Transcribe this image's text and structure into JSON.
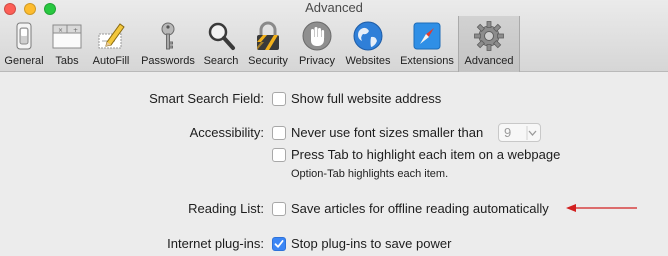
{
  "window": {
    "title": "Advanced",
    "traffic_colors": [
      "#fd5f57",
      "#fdbc2e",
      "#28c840"
    ]
  },
  "toolbar": {
    "tabs": [
      {
        "label": "General",
        "icon": "general-switch-icon",
        "active": false
      },
      {
        "label": "Tabs",
        "icon": "tabs-window-icon",
        "active": false
      },
      {
        "label": "AutoFill",
        "icon": "pencil-form-icon",
        "active": false
      },
      {
        "label": "Passwords",
        "icon": "key-icon",
        "active": false
      },
      {
        "label": "Search",
        "icon": "magnifier-icon",
        "active": false
      },
      {
        "label": "Security",
        "icon": "padlock-icon",
        "active": false
      },
      {
        "label": "Privacy",
        "icon": "hand-icon",
        "active": false
      },
      {
        "label": "Websites",
        "icon": "globe-icon",
        "active": false
      },
      {
        "label": "Extensions",
        "icon": "compass-icon",
        "active": false
      },
      {
        "label": "Advanced",
        "icon": "gear-icon",
        "active": true
      }
    ]
  },
  "settings": {
    "smart_search": {
      "label": "Smart Search Field:",
      "show_full_address": {
        "text": "Show full website address",
        "checked": false
      }
    },
    "accessibility": {
      "label": "Accessibility:",
      "min_font": {
        "text": "Never use font sizes smaller than",
        "checked": false,
        "selected_size": "9"
      },
      "tab_highlight": {
        "text": "Press Tab to highlight each item on a webpage",
        "checked": false
      },
      "note": "Option-Tab highlights each item."
    },
    "reading_list": {
      "label": "Reading List:",
      "save_offline": {
        "text": "Save articles for offline reading automatically",
        "checked": false
      }
    },
    "plugins": {
      "label": "Internet plug-ins:",
      "stop_plugins": {
        "text": "Stop plug-ins to save power",
        "checked": true
      }
    }
  },
  "annotation": {
    "arrow_color": "#d22020"
  },
  "colors": {
    "checkbox_checked": "#3b86f5"
  }
}
